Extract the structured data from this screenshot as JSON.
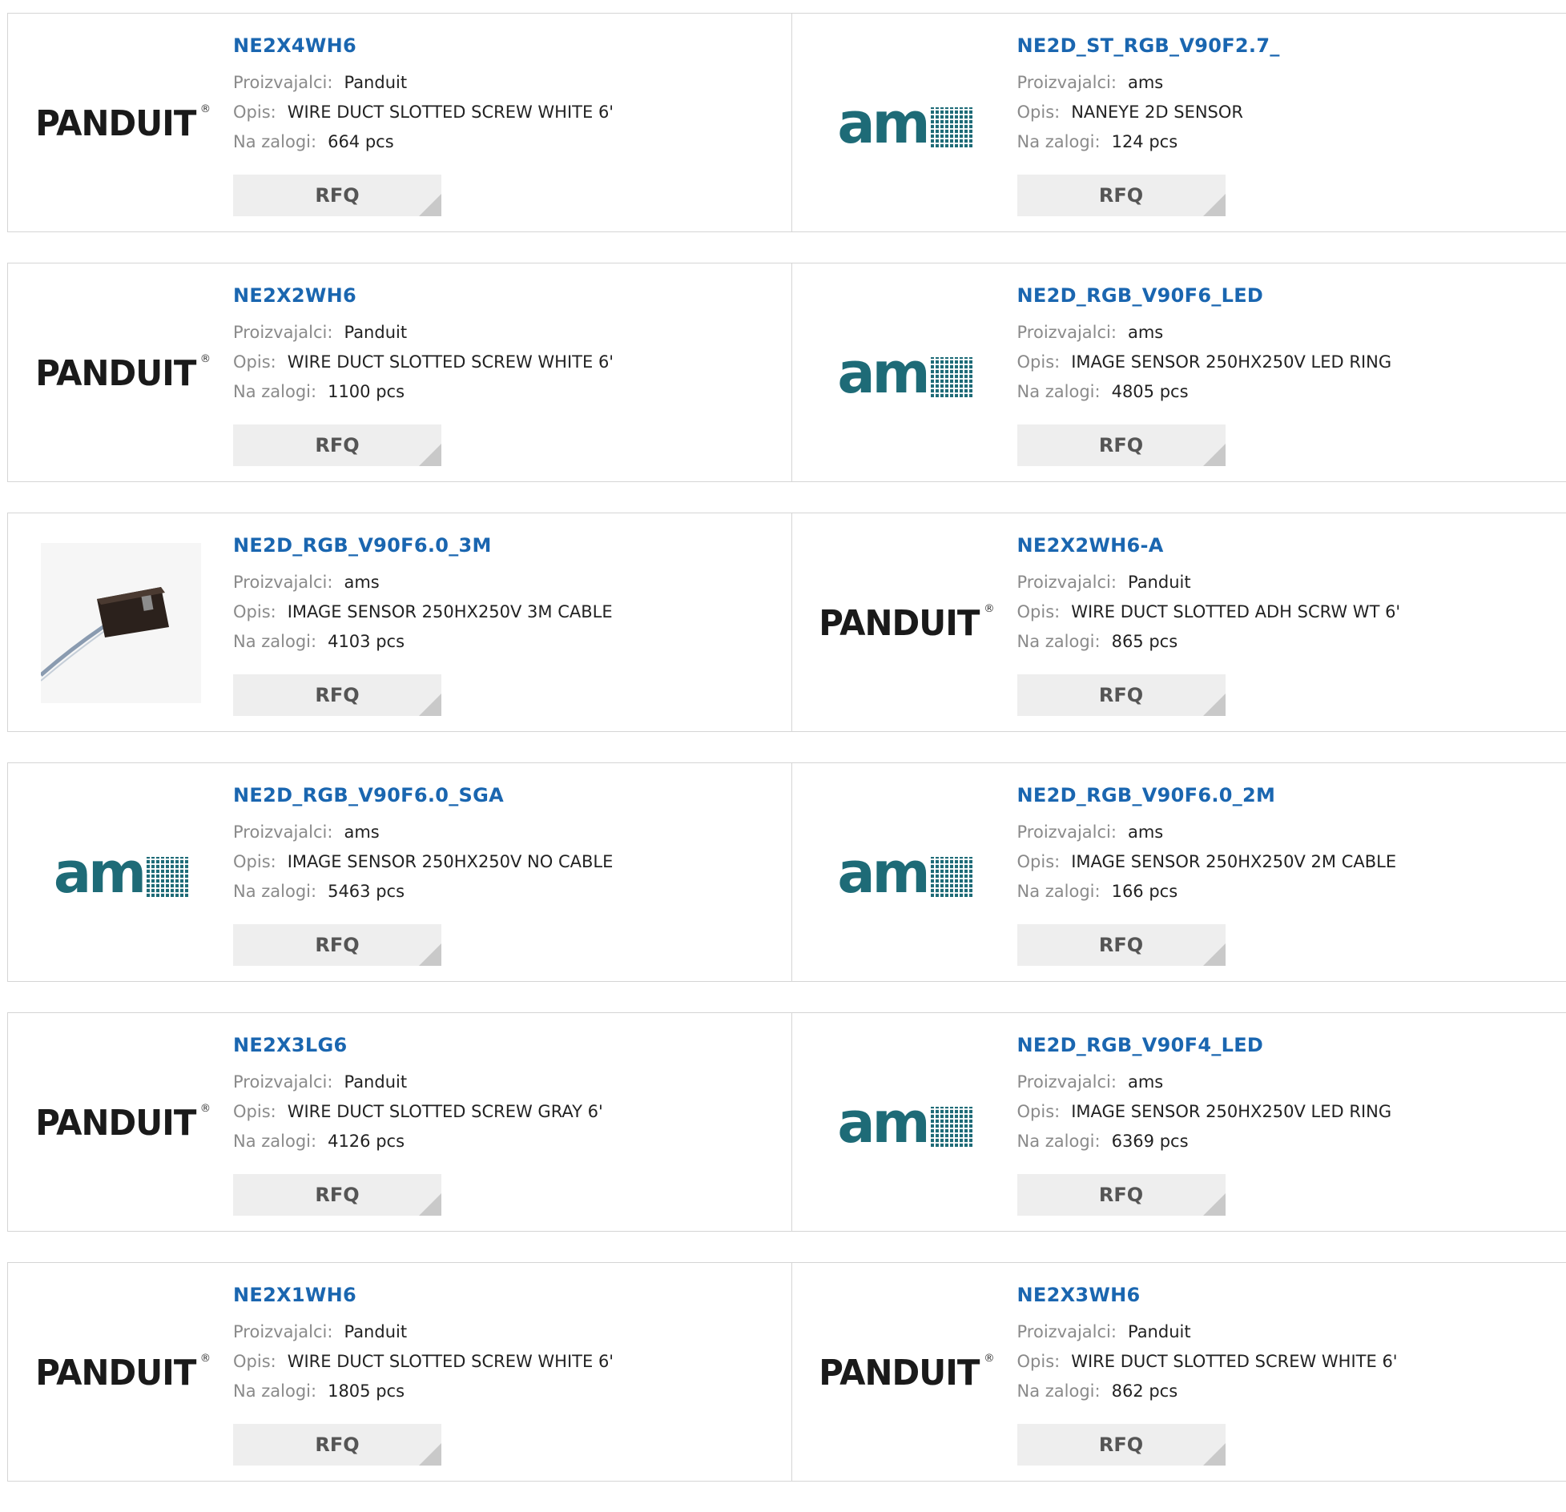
{
  "labels": {
    "manufacturer": "Proizvajalci:",
    "description": "Opis:",
    "stock": "Na zalogi:",
    "rfq": "RFQ"
  },
  "brand_logos": {
    "panduit": "PANDUIT",
    "ams": "am"
  },
  "colors": {
    "link": "#1a66b0",
    "ams_teal": "#1e6b77",
    "button_bg": "#eeeeee"
  },
  "rows": [
    [
      {
        "part": "NE2X4WH6",
        "manufacturer": "Panduit",
        "description": "WIRE DUCT SLOTTED SCREW WHITE 6'",
        "stock": "664 pcs",
        "logo": "panduit"
      },
      {
        "part": "NE2D_ST_RGB_V90F2.7_",
        "manufacturer": "ams",
        "description": "NANEYE 2D SENSOR",
        "stock": "124 pcs",
        "logo": "ams"
      }
    ],
    [
      {
        "part": "NE2X2WH6",
        "manufacturer": "Panduit",
        "description": "WIRE DUCT SLOTTED SCREW WHITE 6'",
        "stock": "1100 pcs",
        "logo": "panduit"
      },
      {
        "part": "NE2D_RGB_V90F6_LED",
        "manufacturer": "ams",
        "description": "IMAGE SENSOR 250HX250V LED RING",
        "stock": "4805 pcs",
        "logo": "ams"
      }
    ],
    [
      {
        "part": "NE2D_RGB_V90F6.0_3M",
        "manufacturer": "ams",
        "description": "IMAGE SENSOR 250HX250V 3M CABLE",
        "stock": "4103 pcs",
        "logo": "photo"
      },
      {
        "part": "NE2X2WH6-A",
        "manufacturer": "Panduit",
        "description": "WIRE DUCT SLOTTED ADH SCRW WT 6'",
        "stock": "865 pcs",
        "logo": "panduit"
      }
    ],
    [
      {
        "part": "NE2D_RGB_V90F6.0_SGA",
        "manufacturer": "ams",
        "description": "IMAGE SENSOR 250HX250V NO CABLE",
        "stock": "5463 pcs",
        "logo": "ams"
      },
      {
        "part": "NE2D_RGB_V90F6.0_2M",
        "manufacturer": "ams",
        "description": "IMAGE SENSOR 250HX250V 2M CABLE",
        "stock": "166 pcs",
        "logo": "ams"
      }
    ],
    [
      {
        "part": "NE2X3LG6",
        "manufacturer": "Panduit",
        "description": "WIRE DUCT SLOTTED SCREW GRAY 6'",
        "stock": "4126 pcs",
        "logo": "panduit"
      },
      {
        "part": "NE2D_RGB_V90F4_LED",
        "manufacturer": "ams",
        "description": "IMAGE SENSOR 250HX250V LED RING",
        "stock": "6369 pcs",
        "logo": "ams"
      }
    ],
    [
      {
        "part": "NE2X1WH6",
        "manufacturer": "Panduit",
        "description": "WIRE DUCT SLOTTED SCREW WHITE 6'",
        "stock": "1805 pcs",
        "logo": "panduit"
      },
      {
        "part": "NE2X3WH6",
        "manufacturer": "Panduit",
        "description": "WIRE DUCT SLOTTED SCREW WHITE 6'",
        "stock": "862 pcs",
        "logo": "panduit"
      }
    ]
  ]
}
